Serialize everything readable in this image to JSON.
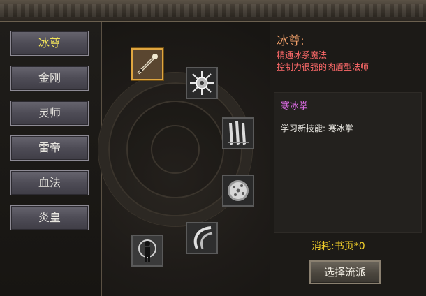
{
  "tabs": [
    {
      "label": "冰尊",
      "active": true
    },
    {
      "label": "金刚",
      "active": false
    },
    {
      "label": "灵师",
      "active": false
    },
    {
      "label": "雷帝",
      "active": false
    },
    {
      "label": "血法",
      "active": false
    },
    {
      "label": "炎皇",
      "active": false
    }
  ],
  "skills": [
    {
      "icon": "staff-icon",
      "selected": true
    },
    {
      "icon": "ice-burst-icon",
      "selected": false
    },
    {
      "icon": "ice-claw-icon",
      "selected": false
    },
    {
      "icon": "frost-orb-icon",
      "selected": false
    },
    {
      "icon": "crescent-wave-icon",
      "selected": false
    },
    {
      "icon": "figure-icon",
      "selected": false
    }
  ],
  "info": {
    "title": "冰尊:",
    "lines": [
      "精通冰系魔法",
      "控制力很强的肉盾型法师"
    ]
  },
  "detail": {
    "title": "寒冰掌",
    "text": "学习新技能: 寒冰掌"
  },
  "cost": "消耗:书页*0",
  "select_button": "选择流派",
  "colors": {
    "active_tab": "#f4e55a",
    "title": "#f2a06a",
    "desc": "#ff6a6a",
    "skill_name": "#d86ae0",
    "cost": "#f2d02a",
    "selected_border": "#e0a640"
  }
}
